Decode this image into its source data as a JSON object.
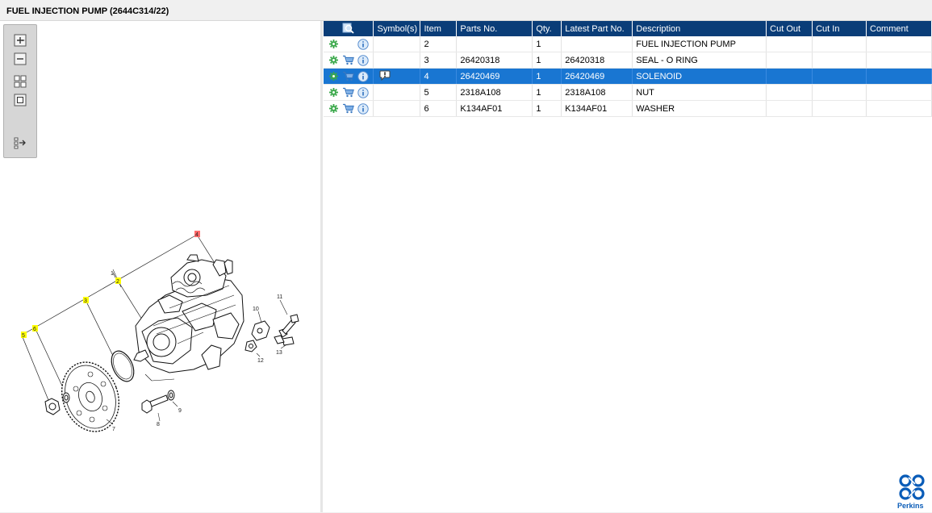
{
  "page": {
    "title": "FUEL INJECTION PUMP (2644C314/22)"
  },
  "toolbar": {
    "zoom_in": "zoom-in",
    "zoom_out": "zoom-out",
    "fit": "fit",
    "actual": "actual-size",
    "export": "export"
  },
  "diagram": {
    "callouts": [
      "1",
      "2",
      "3",
      "4",
      "5",
      "6",
      "7",
      "8",
      "9",
      "10",
      "11",
      "12",
      "13"
    ],
    "highlighted": "4"
  },
  "table": {
    "columns": [
      "",
      "Symbol(s)",
      "Item",
      "Parts No.",
      "Qty.",
      "Latest Part No.",
      "Description",
      "Cut Out",
      "Cut In",
      "Comment"
    ],
    "rows": [
      {
        "cart": false,
        "symbol": "",
        "item": "2",
        "part_no": "",
        "qty": "1",
        "latest": "",
        "description": "FUEL INJECTION PUMP",
        "cut_out": "",
        "cut_in": "",
        "comment": ""
      },
      {
        "cart": true,
        "symbol": "",
        "item": "3",
        "part_no": "26420318",
        "qty": "1",
        "latest": "26420318",
        "description": "SEAL - O RING",
        "cut_out": "",
        "cut_in": "",
        "comment": ""
      },
      {
        "cart": true,
        "symbol": "note-icon",
        "item": "4",
        "part_no": "26420469",
        "qty": "1",
        "latest": "26420469",
        "description": "SOLENOID",
        "cut_out": "",
        "cut_in": "",
        "comment": "",
        "selected": true
      },
      {
        "cart": true,
        "symbol": "",
        "item": "5",
        "part_no": "2318A108",
        "qty": "1",
        "latest": "2318A108",
        "description": "NUT",
        "cut_out": "",
        "cut_in": "",
        "comment": ""
      },
      {
        "cart": true,
        "symbol": "",
        "item": "6",
        "part_no": "K134AF01",
        "qty": "1",
        "latest": "K134AF01",
        "description": "WASHER",
        "cut_out": "",
        "cut_in": "",
        "comment": ""
      }
    ]
  },
  "brand": {
    "name": "Perkins",
    "color": "#0a5cb8"
  },
  "colors": {
    "header": "#0a3d78",
    "selected": "#1976d2",
    "gear": "#3aa84a",
    "callout_yellow": "#ffff00",
    "callout_red": "#ff6b6b"
  }
}
